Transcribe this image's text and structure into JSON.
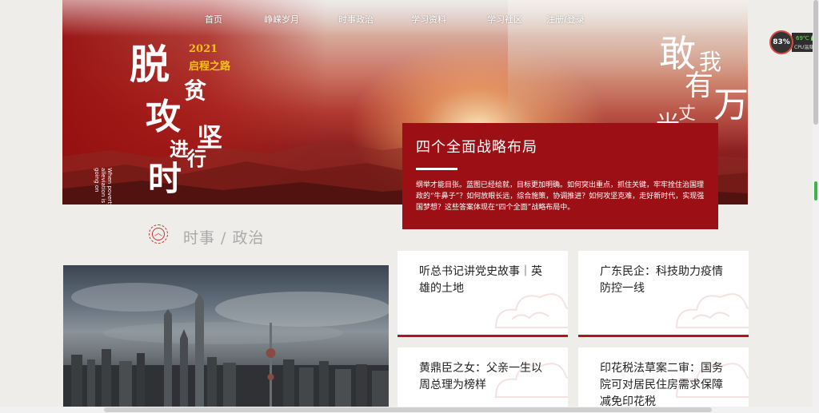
{
  "nav": {
    "items": [
      {
        "label": "首页"
      },
      {
        "label": "峥嵘岁月"
      },
      {
        "label": "时事政治"
      },
      {
        "label": "学习资料"
      },
      {
        "label": "学习社区"
      },
      {
        "label": "注册/登录"
      }
    ]
  },
  "hero": {
    "year": "2021",
    "subtitle": "启程之路",
    "calligraphy": [
      "脱",
      "攻",
      "贫",
      "坚",
      "进",
      "行",
      "时"
    ],
    "english_lines": [
      "When poverty",
      "alleviation is",
      "going on"
    ],
    "right_words": [
      "敢",
      "我",
      "有",
      "万",
      "丈",
      "光"
    ]
  },
  "feature": {
    "title": "四个全面战略布局",
    "body": "纲举才能目张。蓝图已经绘就，目标更加明确。如何突出重点，抓住关键，牢牢拴住治国理政的“牛鼻子”？如何放眼长远，综合施策，协调推进？如何攻坚克难，走好新时代，实现强国梦想？这些答案体现在“四个全面”战略布局中。"
  },
  "section": {
    "title": "时事 / 政治",
    "icon": "chevron-up-icon"
  },
  "news": [
    {
      "title": "听总书记讲党史故事｜英雄的土地"
    },
    {
      "title": "广东民企：科技助力疫情防控一线"
    },
    {
      "title": "黄鼎臣之女：父亲一生以周总理为榜样"
    },
    {
      "title": "印花税法草案二审：国务院可对居民住房需求保障减免印花税"
    }
  ],
  "system": {
    "cpu_usage": "83%",
    "cpu_temp": "69℃",
    "cpu_label": "CPU温度"
  },
  "colors": {
    "accent_red": "#9c0f14",
    "card_underline": "#b3141b",
    "year_gold": "#f4c21a"
  }
}
